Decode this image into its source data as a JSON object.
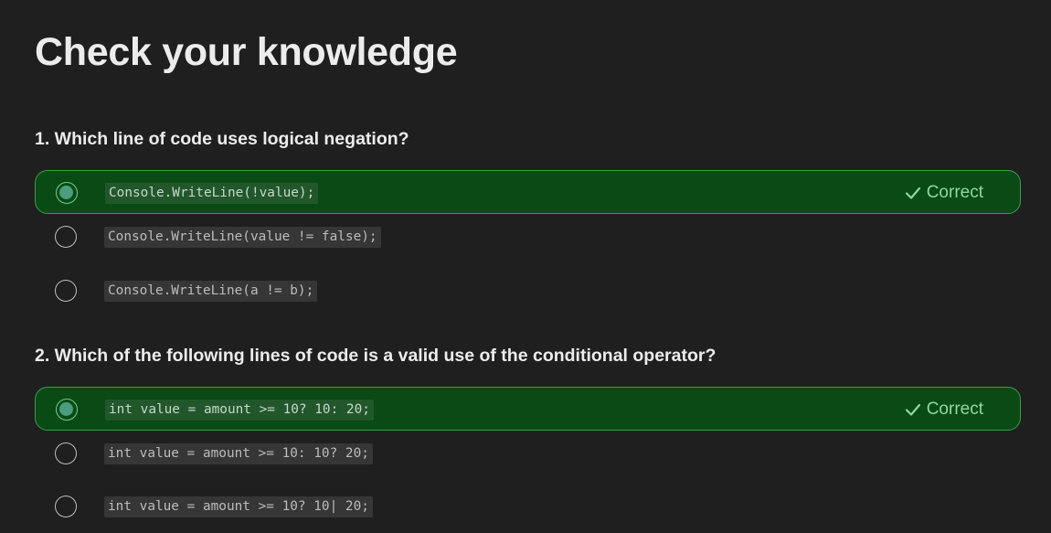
{
  "page": {
    "title": "Check your knowledge"
  },
  "questions": [
    {
      "title": "1. Which line of code uses logical negation?",
      "options": [
        {
          "code": "Console.WriteLine(!value);",
          "selected": true,
          "feedback": "Correct"
        },
        {
          "code": "Console.WriteLine(value != false);",
          "selected": false
        },
        {
          "code": "Console.WriteLine(a != b);",
          "selected": false
        }
      ]
    },
    {
      "title": "2. Which of the following lines of code is a valid use of the conditional operator?",
      "options": [
        {
          "code": "int value = amount >= 10? 10: 20;",
          "selected": true,
          "feedback": "Correct"
        },
        {
          "code": "int value = amount >= 10: 10? 20;",
          "selected": false
        },
        {
          "code": "int value = amount >= 10? 10| 20;",
          "selected": false
        }
      ]
    }
  ],
  "colors": {
    "background": "#1f1f1f",
    "correct_fill": "#0a4a15",
    "correct_border": "#3f9a4c",
    "correct_text": "#8fd89f"
  },
  "icons": {
    "feedback": "check-icon"
  }
}
